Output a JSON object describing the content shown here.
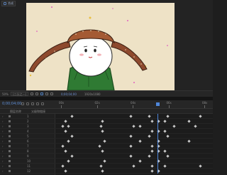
{
  "viewer": {
    "tab_label": "合成"
  },
  "viewer_toolbar": {
    "zoom": "50%",
    "quality": "(二分之一)",
    "timecode": "0;00;04;00",
    "resolution": "1920x1080"
  },
  "timeline": {
    "current_time": "0;00;04;00",
    "ruler_labels": [
      "00s",
      "02s",
      "04s",
      "06s",
      "08s"
    ],
    "col_source": "图层名称",
    "col_parent": "父级和链接",
    "layers": [
      {
        "index": "1"
      },
      {
        "index": "2"
      },
      {
        "index": "3"
      },
      {
        "index": "4"
      },
      {
        "index": "5"
      },
      {
        "index": "6"
      },
      {
        "index": "7"
      },
      {
        "index": "8"
      },
      {
        "index": "9"
      },
      {
        "index": "10"
      },
      {
        "index": "11"
      },
      {
        "index": "12"
      }
    ],
    "keyframes": [
      [
        0.1,
        0.48,
        0.6,
        0.72,
        0.93
      ],
      [
        0.06,
        0.3,
        0.62,
        0.66,
        0.7,
        0.86
      ],
      [
        0.04,
        0.08,
        0.29,
        0.5,
        0.54,
        0.76,
        0.9
      ],
      [
        0.06,
        0.3,
        0.62,
        0.66,
        0.7
      ],
      [
        0.1,
        0.48,
        0.6,
        0.72
      ],
      [
        0.08,
        0.31,
        0.54,
        0.66,
        0.86
      ],
      [
        0.04,
        0.28,
        0.48,
        0.62,
        0.66
      ],
      [
        0.06,
        0.3,
        0.62,
        0.66,
        0.7
      ],
      [
        0.1,
        0.48,
        0.6,
        0.72
      ],
      [
        0.08,
        0.31,
        0.54,
        0.66
      ],
      [
        0.04,
        0.29,
        0.5,
        0.62,
        0.7,
        0.93
      ],
      [
        0.06,
        0.3,
        0.62,
        0.66
      ]
    ],
    "playhead": 0.65,
    "work_area_start": 0.0,
    "work_area_end": 1.0
  },
  "colors": {
    "accent": "#4f86d9",
    "work_area": "#6b9f2f",
    "canvas_bg": "#eee2c6"
  }
}
